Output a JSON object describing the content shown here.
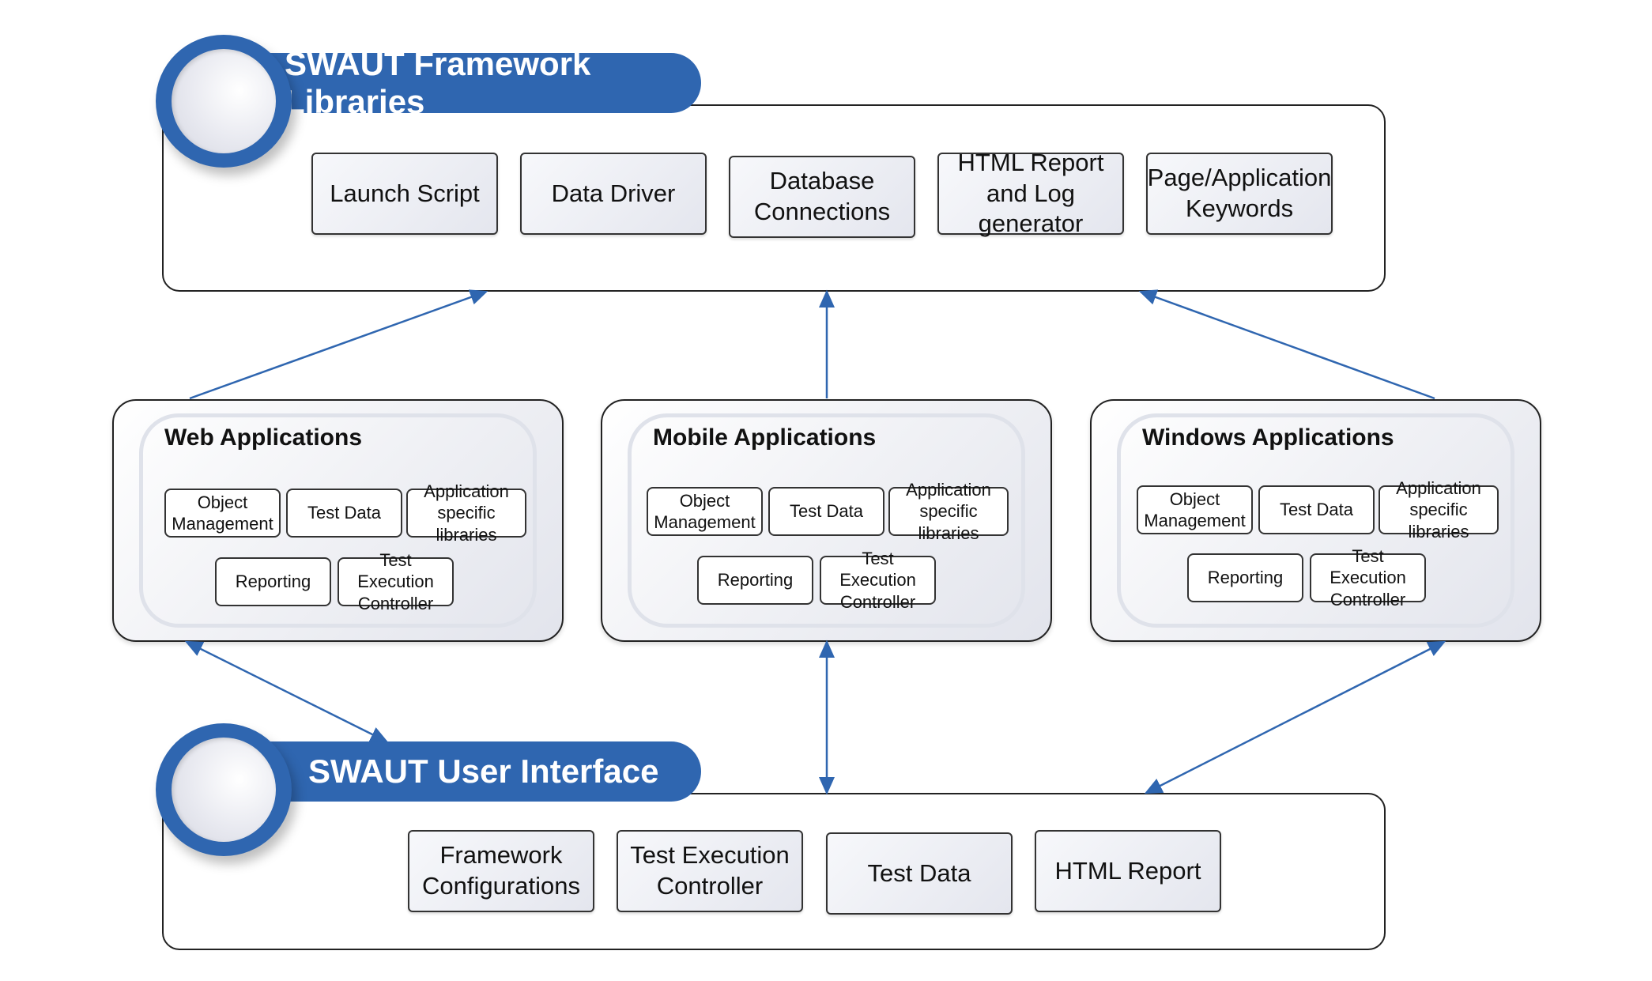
{
  "framework_libraries": {
    "title": "SWAUT Framework Libraries",
    "boxes": [
      "Launch Script",
      "Data Driver",
      "Database\nConnections",
      "HTML Report\nand Log generator",
      "Page/Application\nKeywords"
    ]
  },
  "applications": [
    {
      "title": "Web Applications",
      "modules": [
        "Object\nManagement",
        "Test Data",
        "Application\nspecific libraries",
        "Reporting",
        "Test Execution\nController"
      ]
    },
    {
      "title": "Mobile Applications",
      "modules": [
        "Object\nManagement",
        "Test Data",
        "Application\nspecific libraries",
        "Reporting",
        "Test Execution\nController"
      ]
    },
    {
      "title": "Windows Applications",
      "modules": [
        "Object\nManagement",
        "Test Data",
        "Application\nspecific libraries",
        "Reporting",
        "Test Execution\nController"
      ]
    }
  ],
  "user_interface": {
    "title": "SWAUT User Interface",
    "boxes": [
      "Framework\nConfigurations",
      "Test Execution\nController",
      "Test Data",
      "HTML Report"
    ]
  },
  "colors": {
    "accent": "#2f66b0",
    "arrow": "#2f66b0"
  }
}
